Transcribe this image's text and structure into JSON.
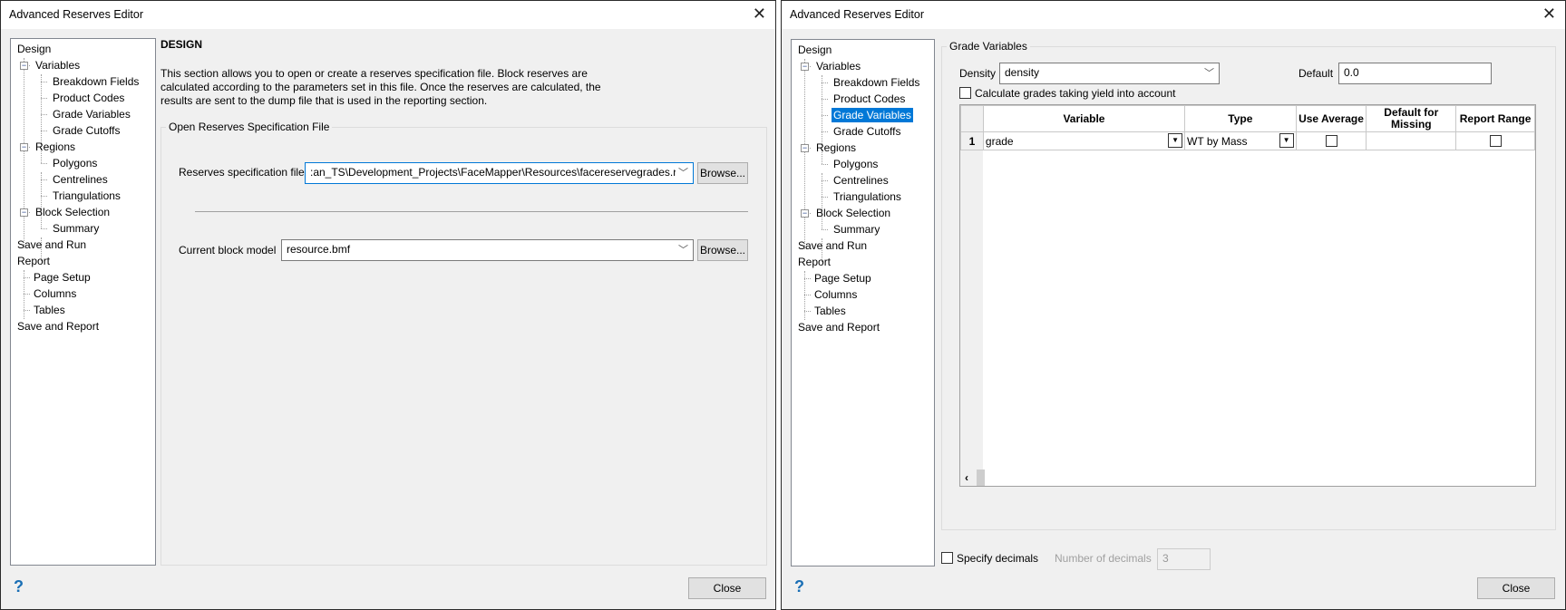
{
  "left": {
    "title": "Advanced Reserves Editor",
    "tree": [
      "Design",
      "Variables",
      "Breakdown Fields",
      "Product Codes",
      "Grade Variables",
      "Grade Cutoffs",
      "Regions",
      "Polygons",
      "Centrelines",
      "Triangulations",
      "Block Selection",
      "Summary",
      "Save and Run",
      "Report",
      "Page Setup",
      "Columns",
      "Tables",
      "Save and Report"
    ],
    "heading": "DESIGN",
    "description": [
      "This section allows you to open or create a reserves specification file.  Block reserves are",
      "calculated according to the parameters set in this file. Once the reserves are calculated, the",
      "results are sent to the dump file that is used in the reporting section."
    ],
    "group_label": "Open Reserves Specification File",
    "spec_label": "Reserves specification file",
    "spec_value": ":an_TS\\Development_Projects\\FaceMapper\\Resources\\facereservegrades.res",
    "model_label": "Current block model",
    "model_value": "resource.bmf",
    "browse": "Browse...",
    "close": "Close",
    "help": "?"
  },
  "right": {
    "title": "Advanced Reserves Editor",
    "tree": [
      "Design",
      "Variables",
      "Breakdown Fields",
      "Product Codes",
      "Grade Variables",
      "Grade Cutoffs",
      "Regions",
      "Polygons",
      "Centrelines",
      "Triangulations",
      "Block Selection",
      "Summary",
      "Save and Run",
      "Report",
      "Page Setup",
      "Columns",
      "Tables",
      "Save and Report"
    ],
    "selected": "Grade Variables",
    "group_label": "Grade Variables",
    "density_label": "Density",
    "density_value": "density",
    "default_label": "Default",
    "default_value": "0.0",
    "yield_label": "Calculate grades taking yield into account",
    "columns": [
      "Variable",
      "Type",
      "Use Average",
      "Default for Missing",
      "Report Range"
    ],
    "rows": [
      {
        "num": "1",
        "variable": "grade",
        "type": "WT by Mass",
        "use_average": false,
        "default_missing": "",
        "report_range": false
      }
    ],
    "specify_decimals": "Specify decimals",
    "num_decimals_label": "Number of decimals",
    "num_decimals_value": "3",
    "close": "Close",
    "help": "?"
  }
}
